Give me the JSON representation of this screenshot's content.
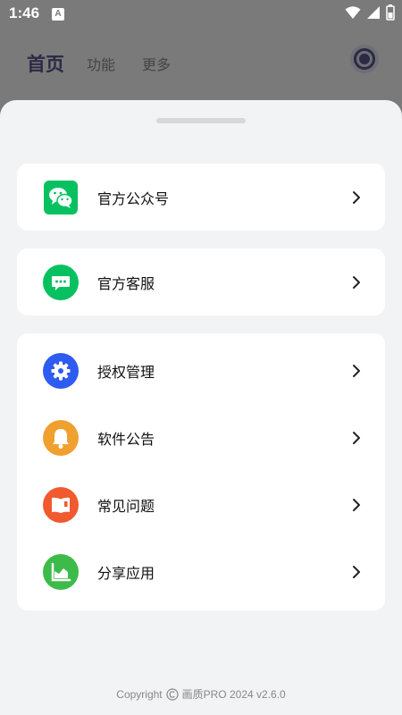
{
  "status_bar": {
    "time": "1:46",
    "notification_icon": "A"
  },
  "top_nav": {
    "tabs": [
      {
        "label": "首页",
        "active": true
      },
      {
        "label": "功能",
        "active": false
      },
      {
        "label": "更多",
        "active": false
      }
    ],
    "record_icon": "record-icon"
  },
  "sheet": {
    "groups": [
      {
        "items": [
          {
            "label": "官方公众号",
            "icon": "wechat-icon",
            "color": "#07c160"
          }
        ]
      },
      {
        "items": [
          {
            "label": "官方客服",
            "icon": "chat-bubble-icon",
            "color": "#07c160"
          }
        ]
      },
      {
        "items": [
          {
            "label": "授权管理",
            "icon": "gear-icon",
            "color": "#2e5bf0"
          },
          {
            "label": "软件公告",
            "icon": "bell-icon",
            "color": "#f0a02e"
          },
          {
            "label": "常见问题",
            "icon": "book-icon",
            "color": "#f05a2e"
          },
          {
            "label": "分享应用",
            "icon": "chart-icon",
            "color": "#3dbb4a"
          }
        ]
      }
    ]
  },
  "footer": {
    "prefix": "Copyright",
    "suffix": "画质PRO 2024 v2.6.0"
  }
}
